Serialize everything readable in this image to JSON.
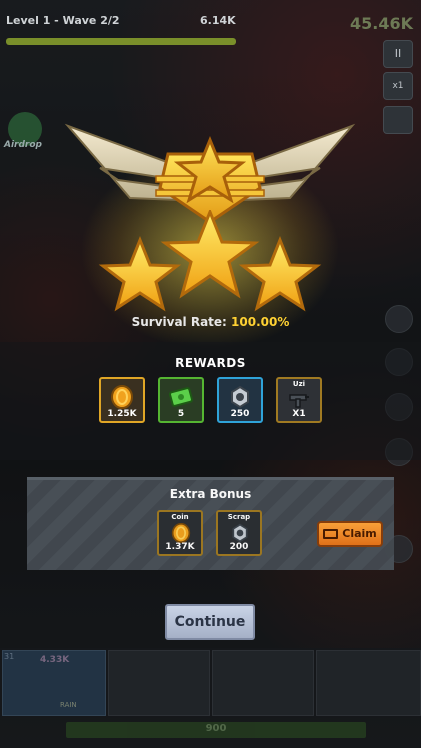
{
  "hud": {
    "level": "Level 1 - Wave 2/2",
    "score": "6.14K",
    "coins": "45.46K",
    "wave_progress": 1.0,
    "pause_label": "II",
    "speed_label": "x1",
    "airdrop_label": "Airdrop"
  },
  "result": {
    "stars_earned": 3,
    "survival_label": "Survival Rate:",
    "survival_value": "100.00%"
  },
  "rewards": {
    "title": "REWARDS",
    "items": [
      {
        "icon": "coin-icon",
        "qty": "1.25K",
        "border": "#e0a626",
        "bg": "#3a3020"
      },
      {
        "icon": "cash-icon",
        "qty": "5",
        "border": "#55b532",
        "bg": "#2a3d24"
      },
      {
        "icon": "scrap-icon",
        "qty": "250",
        "border": "#2fa3d9",
        "bg": "#223342"
      },
      {
        "icon": "uzi-icon",
        "label": "Uzi",
        "qty": "X1",
        "border": "#a07a22",
        "bg": "#2e3136"
      }
    ]
  },
  "bonus": {
    "title": "Extra Bonus",
    "items": [
      {
        "icon": "coin-icon",
        "label": "Coin",
        "qty": "1.37K"
      },
      {
        "icon": "scrap-icon",
        "label": "Scrap",
        "qty": "200"
      }
    ],
    "claim_label": "Claim"
  },
  "continue_label": "Continue",
  "bottom": {
    "hero_level": "31",
    "hero_stats": "4.33K",
    "hero_tag": "RAIN",
    "progress_text": "900"
  },
  "colors": {
    "gold": "#ffd233",
    "claim": "#f39a2e",
    "continue": "#b8c2d9"
  }
}
